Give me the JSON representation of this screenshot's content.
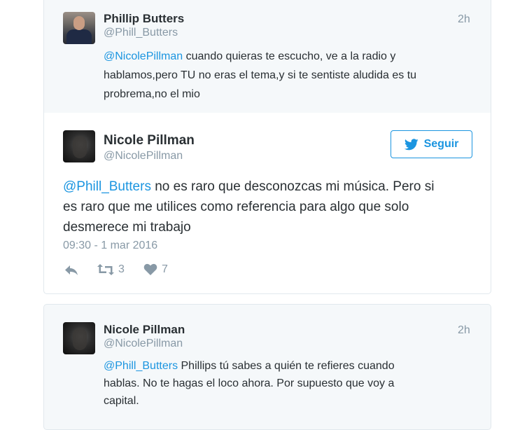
{
  "tweet_above": {
    "author_name": "Phillip Butters",
    "author_handle": "@Phill_Butters",
    "time": "2h",
    "mention": "@NicolePillman",
    "line1_rest": " cuando quieras te escucho, ve a la radio y",
    "line2": "hablamos,pero TU no eras el tema,y si te sentiste aludida es tu",
    "line3": "probrema,no el mio"
  },
  "main_tweet": {
    "author_name": "Nicole Pillman",
    "author_handle": "@NicolePillman",
    "follow_label": "Seguir",
    "mention": "@Phill_Butters",
    "line1_rest": " no es raro que desconozcas mi música. Pero si",
    "line2": "es raro que me utilices como referencia para algo que solo",
    "line3": "desmerece mi trabajo",
    "timestamp": "09:30 - 1 mar 2016",
    "retweet_count": "3",
    "like_count": "7"
  },
  "reply_tweet": {
    "author_name": "Nicole Pillman",
    "author_handle": "@NicolePillman",
    "time": "2h",
    "mention": "@Phill_Butters",
    "line1_rest": " Phillips tú sabes a quién te refieres cuando",
    "line2": "hablas. No te hagas el loco ahora. Por supuesto que voy a",
    "line3": "capital."
  },
  "icons": {
    "reply": "reply-arrow-icon",
    "retweet": "retweet-icon",
    "like": "heart-icon",
    "follow": "twitter-bird-icon"
  },
  "colors": {
    "link": "#1b95e0",
    "muted": "#8899a6",
    "text": "#292f33",
    "ancestor_bg": "#f5f8fa"
  }
}
